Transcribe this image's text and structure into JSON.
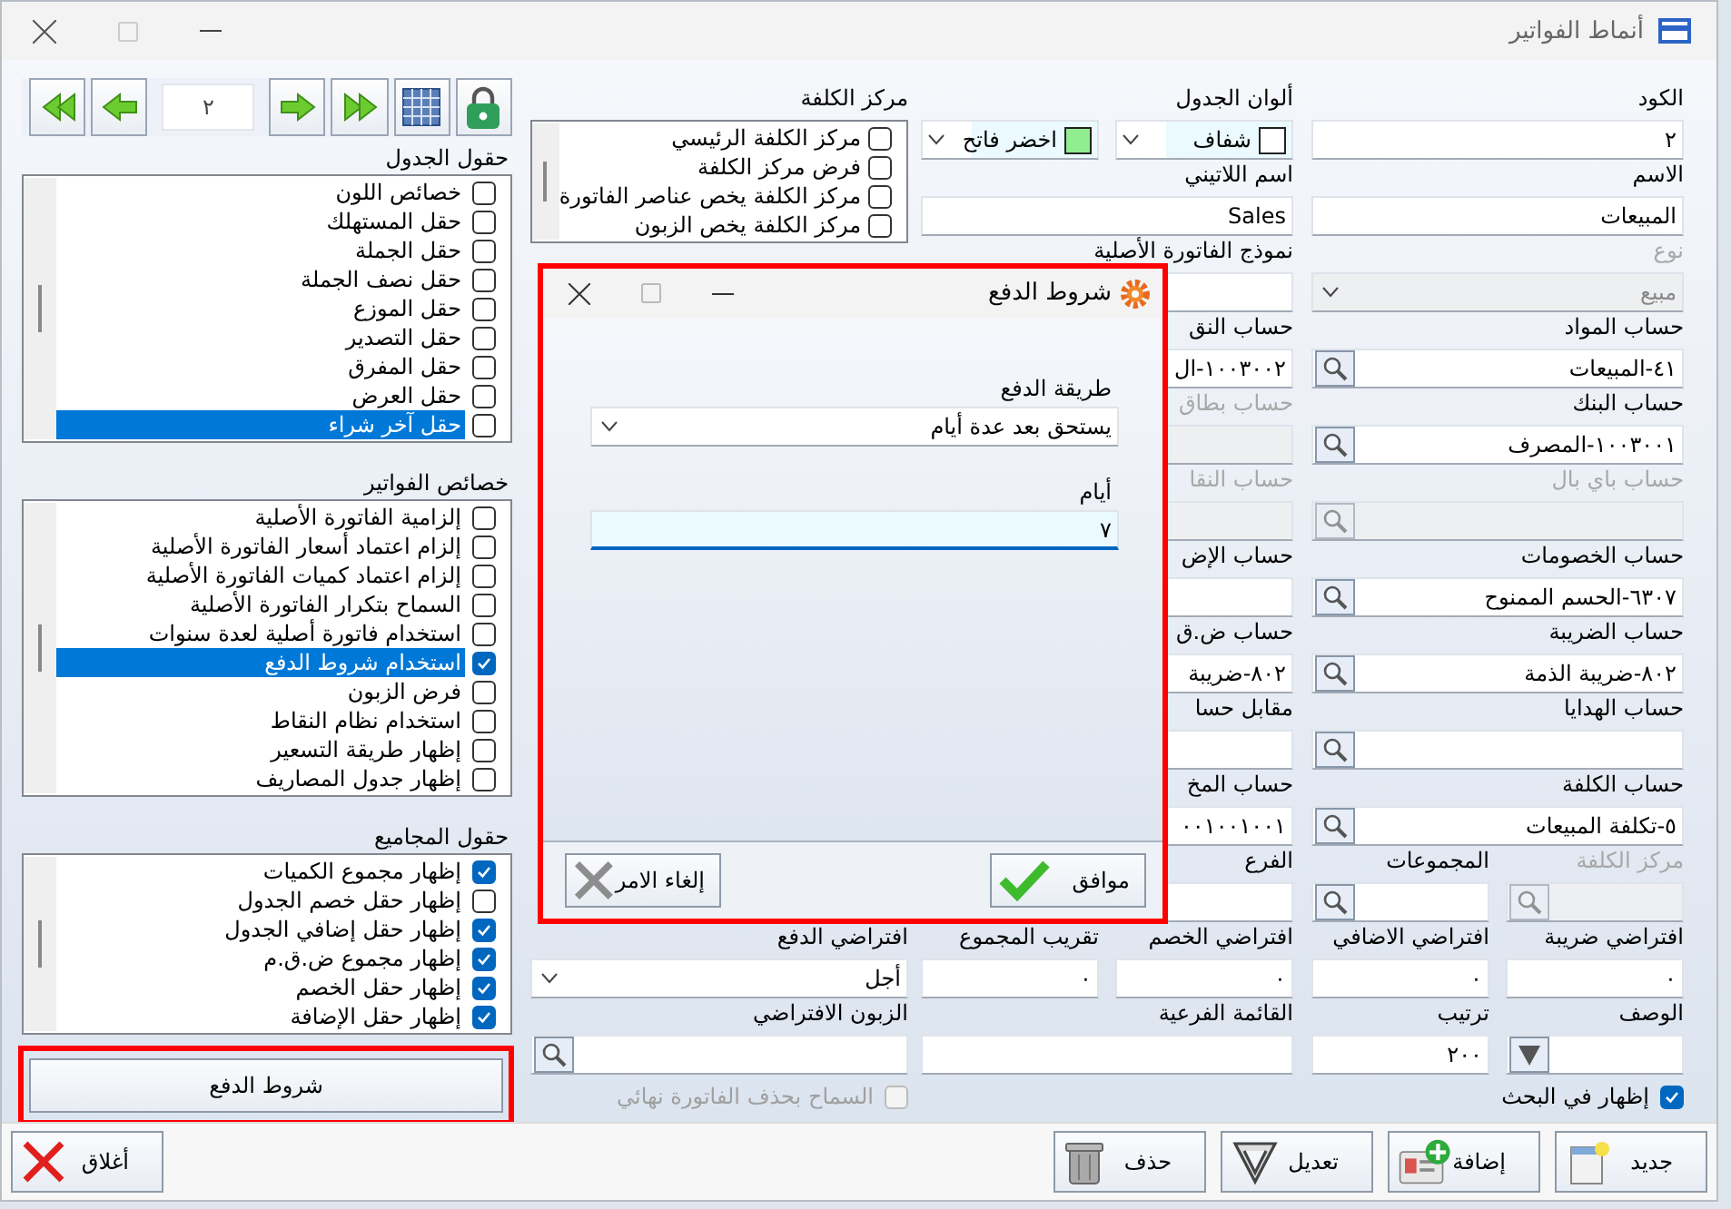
{
  "window": {
    "title": "أنماط الفواتير"
  },
  "navigator": {
    "page": "٢"
  },
  "lists": [
    {
      "title": "حقول الجدول",
      "items": [
        {
          "label": "خصائص اللون",
          "checked": false,
          "selected": false
        },
        {
          "label": "حقل المستهلك",
          "checked": false,
          "selected": false
        },
        {
          "label": "حقل الجملة",
          "checked": false,
          "selected": false
        },
        {
          "label": "حقل نصف الجملة",
          "checked": false,
          "selected": false
        },
        {
          "label": "حقل الموزع",
          "checked": false,
          "selected": false
        },
        {
          "label": "حقل التصدير",
          "checked": false,
          "selected": false
        },
        {
          "label": "حقل المفرق",
          "checked": false,
          "selected": false
        },
        {
          "label": "حقل العرض",
          "checked": false,
          "selected": false
        },
        {
          "label": "حقل آخر شراء",
          "checked": false,
          "selected": true
        }
      ]
    },
    {
      "title": "خصائص الفواتير",
      "items": [
        {
          "label": "إلزامية الفاتورة الأصلية",
          "checked": false,
          "selected": false
        },
        {
          "label": "إلزام اعتماد أسعار الفاتورة الأصلية",
          "checked": false,
          "selected": false
        },
        {
          "label": "إلزام اعتماد كميات الفاتورة الأصلية",
          "checked": false,
          "selected": false
        },
        {
          "label": "السماح بتكرار الفاتورة الأصلية",
          "checked": false,
          "selected": false
        },
        {
          "label": "استخدام فاتورة أصلية لعدة سنوات",
          "checked": false,
          "selected": false
        },
        {
          "label": "استخدام شروط الدفع",
          "checked": true,
          "selected": true
        },
        {
          "label": "فرض الزبون",
          "checked": false,
          "selected": false
        },
        {
          "label": "استخدام نظام النقاط",
          "checked": false,
          "selected": false
        },
        {
          "label": "إظهار طريقة التسعير",
          "checked": false,
          "selected": false
        },
        {
          "label": "إظهار جدول المصاريف",
          "checked": false,
          "selected": false
        }
      ]
    },
    {
      "title": "حقول المجاميع",
      "items": [
        {
          "label": "إظهار مجموع الكميات",
          "checked": true,
          "selected": false
        },
        {
          "label": "إظهار حقل خصم الجدول",
          "checked": false,
          "selected": false
        },
        {
          "label": "إظهار حقل إضافي الجدول",
          "checked": true,
          "selected": false
        },
        {
          "label": "إظهار مجموع ض.ق.م",
          "checked": true,
          "selected": false
        },
        {
          "label": "إظهار حقل الخصم",
          "checked": true,
          "selected": false
        },
        {
          "label": "إظهار حقل الإضافة",
          "checked": true,
          "selected": false
        }
      ]
    }
  ],
  "side_button": {
    "label": "شروط الدفع"
  },
  "form": {
    "rows": [
      [
        {
          "kind": "text",
          "label": "الكود",
          "value": "٢",
          "disabled": false
        },
        {
          "kind": "colors",
          "label": "ألوان الجدول",
          "options": [
            {
              "label": "شفاف",
              "color": "#ffffff"
            },
            {
              "label": "اخضر فاتح",
              "color": "#90ee90"
            }
          ]
        },
        {
          "kind": "checklist",
          "label": "مركز الكلفة",
          "items": [
            {
              "label": "مركز الكلفة الرئيسي",
              "checked": false
            },
            {
              "label": "فرض مركز الكلفة",
              "checked": false
            },
            {
              "label": "مركز الكلفة يخص عناصر الفاتورة",
              "checked": false
            },
            {
              "label": "مركز الكلفة يخص الزبون",
              "checked": false
            }
          ]
        }
      ],
      [
        {
          "kind": "text",
          "label": "الاسم",
          "value": "المبيعات",
          "disabled": false
        },
        {
          "kind": "text",
          "label": "اسم اللاتيني",
          "value": "Sales",
          "disabled": false
        }
      ],
      [
        {
          "kind": "dropdown",
          "label": "نوع",
          "value": "مبيع",
          "disabled": true
        },
        {
          "kind": "text",
          "label": "نموذج الفاتورة الأصلية",
          "disabled": false
        }
      ],
      [
        {
          "kind": "lookup",
          "label": "حساب المواد",
          "value": "٤١-المبيعات",
          "disabled": false
        },
        {
          "kind": "text",
          "label": "حساب النق",
          "value": "١٠٠٣٠٠٢-ال",
          "disabled": false
        }
      ],
      [
        {
          "kind": "lookup",
          "label": "حساب البنك",
          "value": "١٠٠٣٠٠١-المصرف",
          "disabled": false
        },
        {
          "kind": "text",
          "label": "حساب بطاق",
          "disabled": true
        }
      ],
      [
        {
          "kind": "lookup",
          "label": "حساب باي بال",
          "disabled": true
        },
        {
          "kind": "text",
          "label": "حساب النقا",
          "disabled": true
        }
      ],
      [
        {
          "kind": "lookup",
          "label": "حساب الخصومات",
          "value": "٦٣٠٧-الحسم الممنوح",
          "disabled": false
        },
        {
          "kind": "text",
          "label": "حساب الإض",
          "disabled": false
        }
      ],
      [
        {
          "kind": "lookup",
          "label": "حساب الضريبة",
          "value": "٨٠٢-ضريبة الذمة",
          "disabled": false
        },
        {
          "kind": "text",
          "label": "حساب ض.ق",
          "value": "٨٠٢-ضريبة",
          "disabled": false
        }
      ],
      [
        {
          "kind": "lookup",
          "label": "حساب الهدايا",
          "disabled": false
        },
        {
          "kind": "text",
          "label": "مقابل حسا",
          "disabled": false
        }
      ],
      [
        {
          "kind": "lookup",
          "label": "حساب الكلفة",
          "value": "٥-تكلفة المبيعات",
          "disabled": false
        },
        {
          "kind": "text",
          "label": "حساب المخ",
          "value": "٠٠١٠٠١٠٠١",
          "disabled": false
        }
      ],
      [
        {
          "kind": "group",
          "fields": [
            {
              "kind": "lookup",
              "label": "مركز الكلفة",
              "disabled": true
            },
            {
              "kind": "lookup",
              "label": "المجموعات",
              "disabled": false
            }
          ]
        },
        {
          "kind": "text",
          "label": "الفرع",
          "disabled": false
        }
      ],
      [
        {
          "kind": "group",
          "fields": [
            {
              "kind": "text",
              "label": "افتراضي ضريبة",
              "value": "٠",
              "disabled": false
            },
            {
              "kind": "text",
              "label": "افتراضي الاضافي",
              "value": "٠",
              "disabled": false
            }
          ]
        },
        {
          "kind": "group",
          "fields": [
            {
              "kind": "text",
              "label": "افتراضي الخصم",
              "value": "٠",
              "disabled": false
            },
            {
              "kind": "text",
              "label": "تقريب المجموع",
              "value": "٠",
              "disabled": false
            }
          ]
        },
        {
          "kind": "dropdown",
          "label": "افتراضي الدفع",
          "value": "أجل",
          "disabled": false
        }
      ],
      [
        {
          "kind": "group",
          "fields": [
            {
              "kind": "picker",
              "label": "الوصف",
              "disabled": false
            },
            {
              "kind": "text",
              "label": "ترتيب",
              "value": "٢٠٠",
              "disabled": false
            }
          ]
        },
        {
          "kind": "text",
          "label": "القائمة الفرعية",
          "disabled": false
        },
        {
          "kind": "lookup",
          "label": "الزبون الافتراضي",
          "disabled": false
        }
      ]
    ],
    "options": [
      {
        "label": "إظهار في البحث",
        "checked": true,
        "disabled": false
      },
      {
        "label": "السماح بحذف الفاتورة نهائي",
        "checked": false,
        "disabled": true
      }
    ]
  },
  "actions": [
    {
      "kind": "new",
      "label": "جديد"
    },
    {
      "kind": "add",
      "label": "إضافة"
    },
    {
      "kind": "edit",
      "label": "تعديل"
    },
    {
      "kind": "delete",
      "label": "حذف"
    }
  ],
  "close_button": {
    "kind": "close",
    "label": "أغلاق"
  },
  "dialog": {
    "title": "شروط الدفع",
    "fields": [
      {
        "kind": "dropdown",
        "label": "طريقة الدفع",
        "value": "يستحق بعد عدة أيام",
        "focused": false
      },
      {
        "kind": "text",
        "label": "أيام",
        "value": "٧",
        "focused": true
      }
    ],
    "buttons": [
      {
        "kind": "ok",
        "label": "موافق"
      },
      {
        "kind": "cancel",
        "label": "إلغاء الامر"
      }
    ]
  }
}
